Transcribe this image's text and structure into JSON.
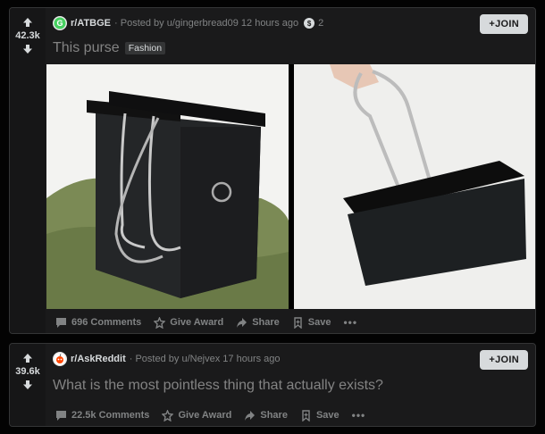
{
  "posts": [
    {
      "score": "42.3k",
      "subreddit": "r/ATBGE",
      "posted_by": "· Posted by u/gingerbread09 12 hours ago",
      "awards_count": "2",
      "join_label": "+JOIN",
      "title": "This purse",
      "flair": "Fashion",
      "comments": "696 Comments",
      "give_award": "Give Award",
      "share": "Share",
      "save": "Save",
      "more": "•••"
    },
    {
      "score": "39.6k",
      "subreddit": "r/AskReddit",
      "posted_by": "· Posted by u/Nejvex 17 hours ago",
      "join_label": "+JOIN",
      "title": "What is the most pointless thing that actually exists?",
      "comments": "22.5k Comments",
      "give_award": "Give Award",
      "share": "Share",
      "save": "Save",
      "more": "•••"
    }
  ],
  "colors": {
    "page_bg": "#030303",
    "card_bg": "#1a1a1b",
    "border": "#343536",
    "text": "#d7dadc",
    "muted": "#818384",
    "title_visited": "#838383"
  },
  "icons": {
    "upvote": "arrow-up-icon",
    "downvote": "arrow-down-icon",
    "comments": "comment-bubble-icon",
    "award": "award-icon",
    "share": "share-arrow-icon",
    "save": "bookmark-icon"
  }
}
